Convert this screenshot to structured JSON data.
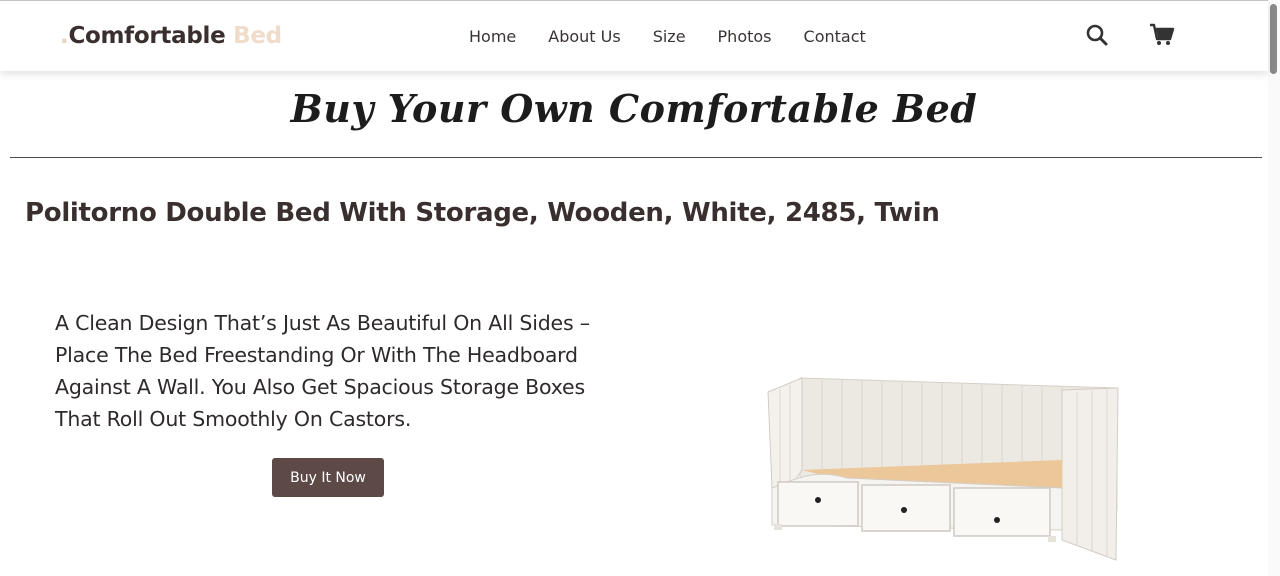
{
  "brand": {
    "dot": ".",
    "name": "Comfortable",
    "accent": "Bed"
  },
  "nav": {
    "items": [
      "Home",
      "About Us",
      "Size",
      "Photos",
      "Contact"
    ]
  },
  "header": {
    "icons": [
      "search-icon",
      "cart-icon"
    ]
  },
  "hero": {
    "title": "Buy Your Own Comfortable Bed"
  },
  "product": {
    "title": "Politorno Double Bed With Storage, Wooden, White, 2485, Twin",
    "description": "A Clean Design That’s Just As Beautiful On All Sides – Place The Bed Freestanding Or With The Headboard Against A Wall. You Also Get Spacious Storage Boxes That Roll Out Smoothly On Castors.",
    "cta": "Buy It Now"
  },
  "colors": {
    "brand_dark": "#3a2f2f",
    "brand_accent": "#f0dcc9",
    "button": "#5d4a47"
  }
}
